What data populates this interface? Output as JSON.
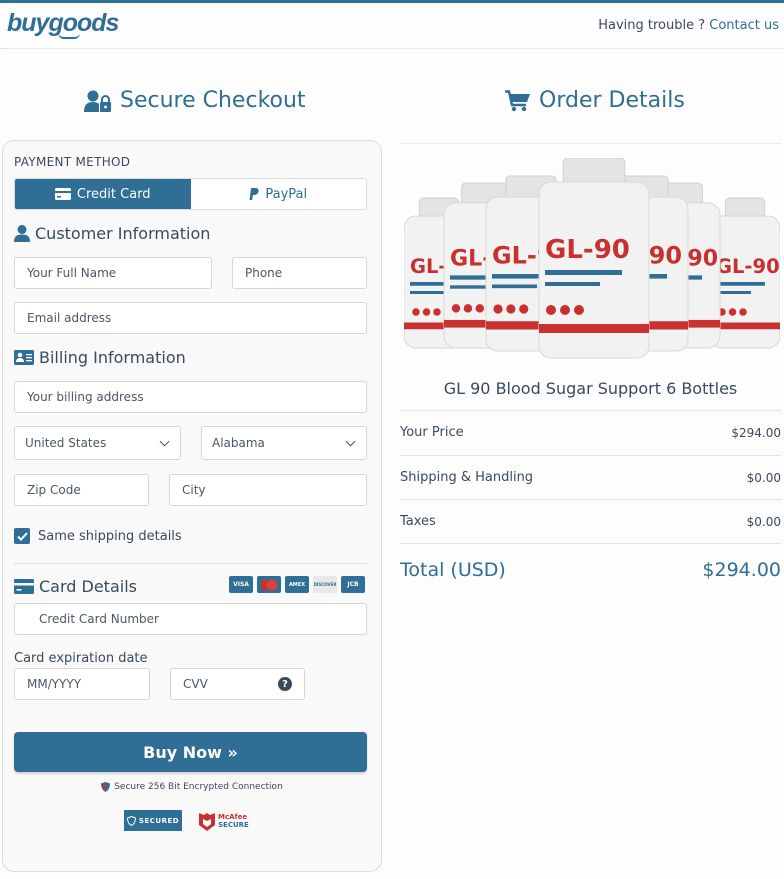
{
  "header": {
    "logo": "buygoods",
    "help_text": "Having trouble ?",
    "help_link": "Contact us"
  },
  "checkout": {
    "title": "Secure Checkout",
    "payment_method_label": "PAYMENT METHOD",
    "payment_tabs": [
      {
        "label": "Credit Card",
        "active": true
      },
      {
        "label": "PayPal",
        "active": false
      }
    ],
    "customer_info": {
      "title": "Customer Information",
      "full_name_placeholder": "Your Full Name",
      "phone_placeholder": "Phone",
      "email_placeholder": "Email address"
    },
    "billing_info": {
      "title": "Billing Information",
      "address_placeholder": "Your billing address",
      "country_value": "United States",
      "state_value": "Alabama",
      "zip_placeholder": "Zip Code",
      "city_placeholder": "City",
      "same_shipping_label": "Same shipping details",
      "same_shipping_checked": true
    },
    "card_details": {
      "title": "Card Details",
      "card_logos": [
        "VISA",
        "MasterCard",
        "AMEX",
        "DISCOVER",
        "JCB"
      ],
      "card_number_placeholder": "Credit Card Number",
      "expiration_label": "Card expiration date",
      "expiration_placeholder": "MM/YYYY",
      "cvv_placeholder": "CVV",
      "cvv_help": "?"
    },
    "buy_button": "Buy Now »",
    "secure_note": "Secure 256 Bit Encrypted Connection",
    "badges": {
      "secured": "SECURED",
      "mcafee_line1": "McAfee",
      "mcafee_line2": "SECURE"
    }
  },
  "order": {
    "title": "Order Details",
    "product_name": "GL 90 Blood Sugar Support 6 Bottles",
    "product_image_label": "GL-90",
    "rows": [
      {
        "label": "Your Price",
        "value": "$294.00"
      },
      {
        "label": "Shipping & Handling",
        "value": "$0.00"
      },
      {
        "label": "Taxes",
        "value": "$0.00"
      }
    ],
    "total_label": "Total (USD)",
    "total_value": "$294.00"
  },
  "colors": {
    "brand": "#2f6e95",
    "accent_red": "#c8312f"
  }
}
